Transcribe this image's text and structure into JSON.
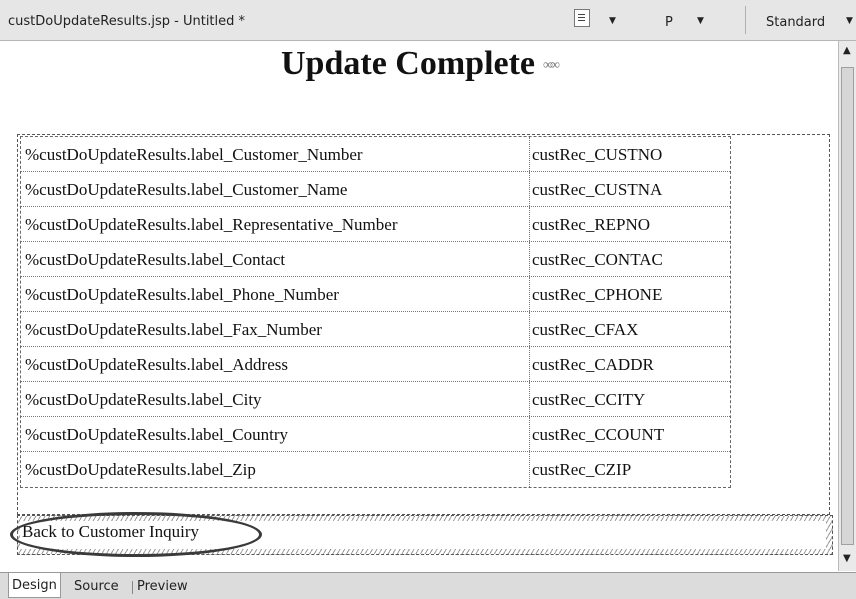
{
  "window": {
    "title": "custDoUpdateResults.jsp - Untitled *"
  },
  "toolbar": {
    "paragraph_icon": "paragraph-format-icon",
    "style_label": "P",
    "font_label": "Standard"
  },
  "page": {
    "heading": "Update Complete",
    "heading_icon": "link-icon",
    "rows": [
      {
        "label": "%custDoUpdateResults.label_Customer_Number",
        "value": "custRec_CUSTNO"
      },
      {
        "label": "%custDoUpdateResults.label_Customer_Name",
        "value": "custRec_CUSTNA"
      },
      {
        "label": "%custDoUpdateResults.label_Representative_Number",
        "value": "custRec_REPNO"
      },
      {
        "label": "%custDoUpdateResults.label_Contact",
        "value": "custRec_CONTAC"
      },
      {
        "label": "%custDoUpdateResults.label_Phone_Number",
        "value": "custRec_CPHONE"
      },
      {
        "label": "%custDoUpdateResults.label_Fax_Number",
        "value": "custRec_CFAX"
      },
      {
        "label": "%custDoUpdateResults.label_Address",
        "value": "custRec_CADDR"
      },
      {
        "label": "%custDoUpdateResults.label_City",
        "value": "custRec_CCITY"
      },
      {
        "label": "%custDoUpdateResults.label_Country",
        "value": "custRec_CCOUNT"
      },
      {
        "label": "%custDoUpdateResults.label_Zip",
        "value": "custRec_CZIP"
      }
    ],
    "back_link": "Back to Customer Inquiry"
  },
  "tabs": [
    {
      "label": "Design",
      "active": true
    },
    {
      "label": "Source",
      "active": false
    },
    {
      "label": "Preview",
      "active": false
    }
  ]
}
